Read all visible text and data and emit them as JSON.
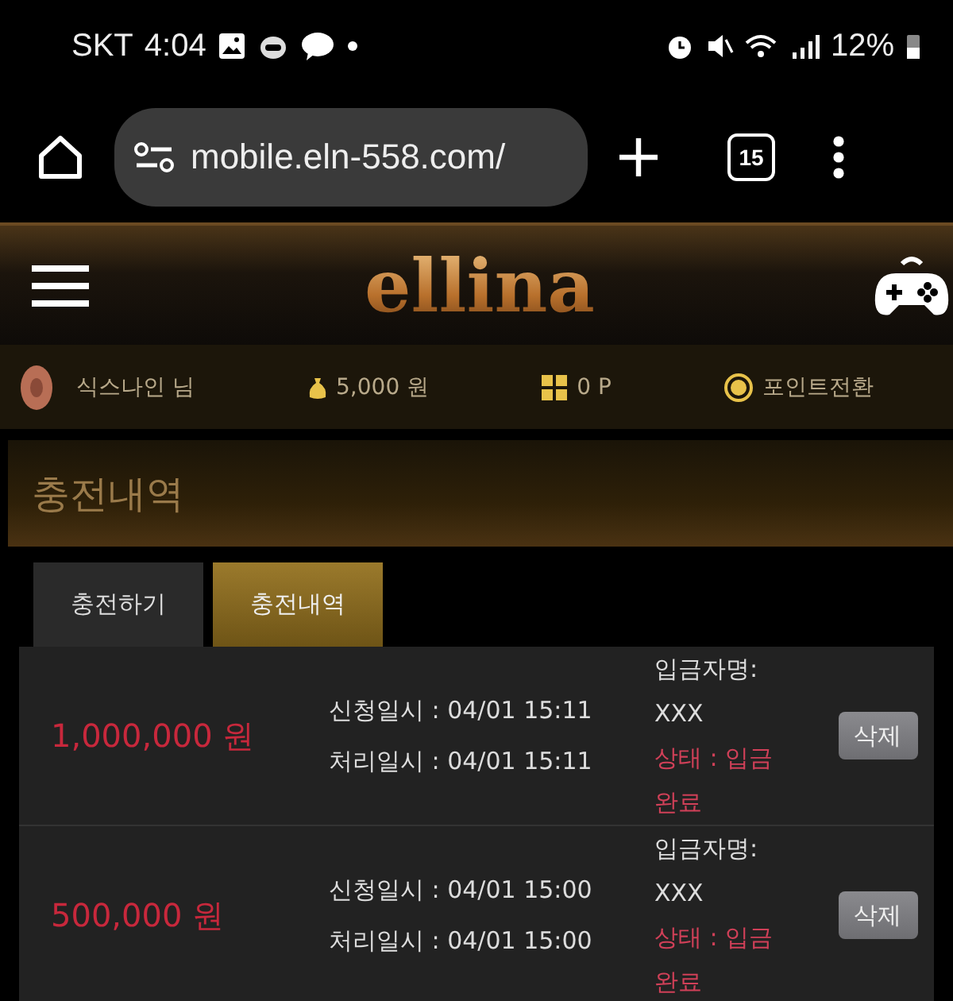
{
  "status_bar": {
    "carrier": "SKT",
    "time": "4:04",
    "battery": "12%"
  },
  "browser": {
    "url": "mobile.eln-558.com/",
    "tab_count": "15"
  },
  "header": {
    "logo": "ellina"
  },
  "user_bar": {
    "name": "식스나인 님",
    "money": "5,000 원",
    "points": "0 P",
    "convert": "포인트전환"
  },
  "page_title": "충전내역",
  "tabs": [
    {
      "label": "충전하기",
      "selected": false
    },
    {
      "label": "충전내역",
      "selected": true
    }
  ],
  "rows": [
    {
      "amount": "1,000,000 원",
      "requested": "신청일시 : 04/01 15:11",
      "processed": "처리일시 : 04/01 15:11",
      "depositor_label": "입금자명:",
      "depositor": "XXX",
      "status": "상태 : 입금완료",
      "delete": "삭제"
    },
    {
      "amount": "500,000 원",
      "requested": "신청일시 : 04/01 15:00",
      "processed": "처리일시 : 04/01 15:00",
      "depositor_label": "입금자명:",
      "depositor": "XXX",
      "status": "상태 : 입금완료",
      "delete": "삭제"
    }
  ]
}
